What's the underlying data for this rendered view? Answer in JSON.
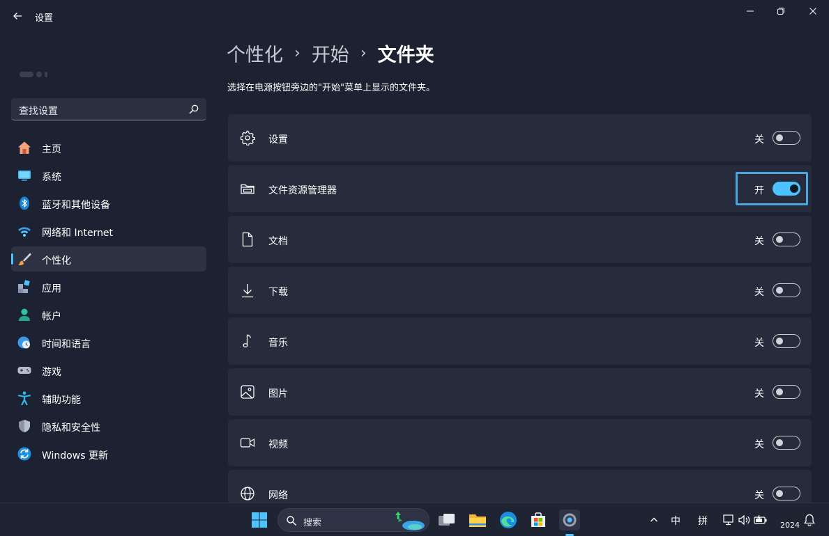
{
  "app": {
    "title": "设置"
  },
  "search": {
    "placeholder": "查找设置"
  },
  "sidebar": {
    "items": [
      {
        "label": "主页",
        "icon": "home-icon"
      },
      {
        "label": "系统",
        "icon": "system-icon"
      },
      {
        "label": "蓝牙和其他设备",
        "icon": "bluetooth-icon"
      },
      {
        "label": "网络和 Internet",
        "icon": "wifi-icon"
      },
      {
        "label": "个性化",
        "icon": "brush-icon",
        "selected": true
      },
      {
        "label": "应用",
        "icon": "apps-icon"
      },
      {
        "label": "帐户",
        "icon": "account-icon"
      },
      {
        "label": "时间和语言",
        "icon": "clock-globe-icon"
      },
      {
        "label": "游戏",
        "icon": "gamepad-icon"
      },
      {
        "label": "辅助功能",
        "icon": "accessibility-icon"
      },
      {
        "label": "隐私和安全性",
        "icon": "shield-icon"
      },
      {
        "label": "Windows 更新",
        "icon": "update-icon"
      }
    ]
  },
  "breadcrumb": {
    "items": [
      "个性化",
      "开始",
      "文件夹"
    ]
  },
  "description": "选择在电源按钮旁边的\"开始\"菜单上显示的文件夹。",
  "folders": [
    {
      "label": "设置",
      "state": "关",
      "on": false,
      "icon": "gear-icon"
    },
    {
      "label": "文件资源管理器",
      "state": "开",
      "on": true,
      "icon": "file-explorer-icon"
    },
    {
      "label": "文档",
      "state": "关",
      "on": false,
      "icon": "document-icon"
    },
    {
      "label": "下载",
      "state": "关",
      "on": false,
      "icon": "download-icon"
    },
    {
      "label": "音乐",
      "state": "关",
      "on": false,
      "icon": "music-icon"
    },
    {
      "label": "图片",
      "state": "关",
      "on": false,
      "icon": "picture-icon"
    },
    {
      "label": "视频",
      "state": "关",
      "on": false,
      "icon": "video-icon"
    },
    {
      "label": "网络",
      "state": "关",
      "on": false,
      "icon": "network-icon"
    }
  ],
  "taskbar": {
    "search_label": "搜索",
    "tray": {
      "ime_mode": "中",
      "ime_layout": "拼",
      "clock": "2024"
    }
  },
  "colors": {
    "accent": "#4cc2ff",
    "background": "#1d2232",
    "card": "#262c3c"
  }
}
